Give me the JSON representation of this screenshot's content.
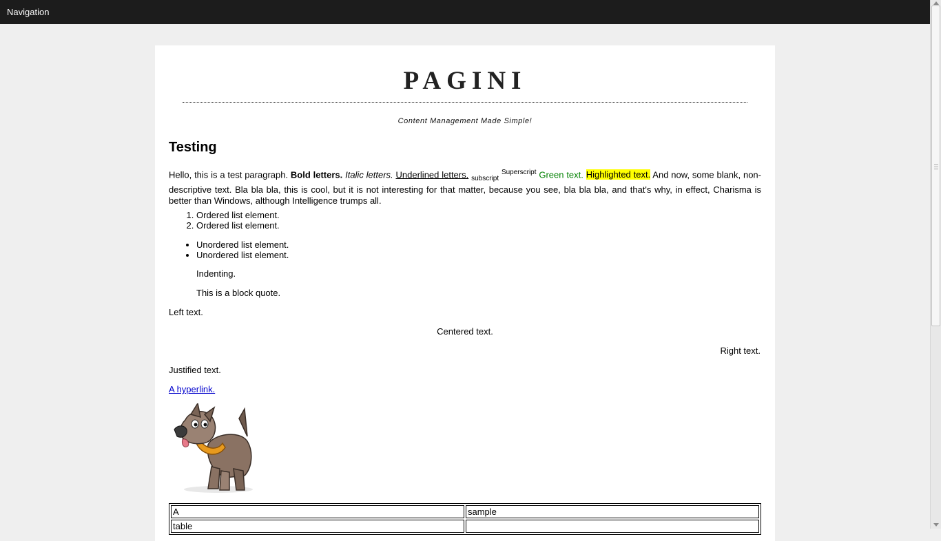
{
  "topbar": {
    "label": "Navigation"
  },
  "site": {
    "title": "PAGINI",
    "tagline": "Content Management Made Simple!"
  },
  "article": {
    "heading": "Testing",
    "para": {
      "intro": "Hello, this is a test paragraph. ",
      "bold": "Bold letters.",
      "italic": "Italic letters.",
      "underline": "Underlined letters.",
      "subscript": "subscript",
      "superscript": "Superscript",
      "green": "Green text.",
      "highlight": "Highlighted text.",
      "rest": " And now, some blank, non-descriptive text. Bla bla bla, this is cool, but it is not interesting for that matter, because you see, bla bla bla, and that's why, in effect, Charisma is better than Windows, although Intelligence trumps all."
    },
    "ordered_list": [
      "Ordered list element.",
      "Ordered list element."
    ],
    "unordered_list": [
      "Unordered list element.",
      "Unordered list element."
    ],
    "indent": "Indenting.",
    "blockquote": "This is a block quote.",
    "left": "Left text.",
    "center": "Centered text.",
    "right": "Right text.",
    "justified": "Justified text.",
    "hyperlink": "A hyperlink.",
    "image_icon": "cartoon-dog-icon",
    "table": [
      [
        "A",
        "sample"
      ],
      [
        "table",
        ""
      ]
    ]
  },
  "colors": {
    "topbar": "#1c1c1c",
    "background": "#efefef",
    "green_text": "#008000",
    "highlight": "#ffff00",
    "link": "#0000cc"
  }
}
